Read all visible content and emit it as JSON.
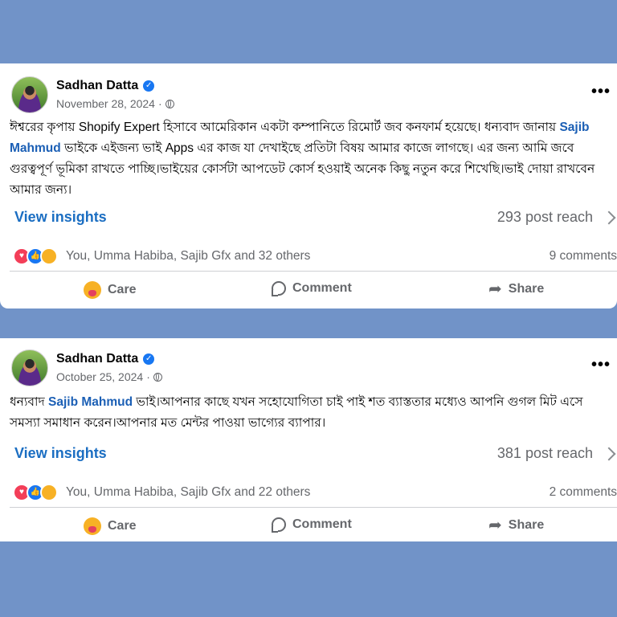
{
  "posts": [
    {
      "author": "Sadhan Datta",
      "verified_icon": "verified-badge-icon",
      "date": "November 28, 2024",
      "separator": "·",
      "text_part1": "ঈশ্বরের কৃপায় Shopify Expert হিসাবে আমেরিকান একটা কম্পানিতে রিমোর্ট জব কনফার্ম হয়েছে। ধন্যবাদ জানায় ",
      "mention": "Sajib Mahmud",
      "text_part2": "  ভাইকে এইজন্য ভাই Apps এর কাজ যা দেখাইছে প্রতিটা বিষয় আমার কাজে লাগছে। এর জন্য আমি জবে গুরত্বপূর্ণ ভূমিকা রাখতে পাচ্ছি।ভাইয়ের কোর্সটা আপডেট কোর্স হওয়াই অনেক কিছু নতুন করে শিখেছি।ভাই দোয়া রাখবেন আমার জন্য।",
      "insights_label": "View insights",
      "reach": "293 post reach",
      "reactors": "You, Umma Habiba, Sajib Gfx and 32 others",
      "comments": "9 comments",
      "actions": {
        "care": "Care",
        "comment": "Comment",
        "share": "Share"
      }
    },
    {
      "author": "Sadhan Datta",
      "verified_icon": "verified-badge-icon",
      "date": "October 25, 2024",
      "separator": "·",
      "text_part1": "ধন্যবাদ ",
      "mention": "Sajib Mahmud",
      "text_part2": "  ভাই।আপনার কাছে যখন সহোযোগিতা চাই পাই শত ব্যাস্ততার মধ্যেও আপনি গুগল মিট এসে সমস্যা সমাধান করেন।আপনার মত মেন্টর পাওয়া ভাগ্যের ব্যাপার।",
      "insights_label": "View insights",
      "reach": "381 post reach",
      "reactors": "You, Umma Habiba, Sajib Gfx and 22 others",
      "comments": "2 comments",
      "actions": {
        "care": "Care",
        "comment": "Comment",
        "share": "Share"
      }
    }
  ],
  "colors": {
    "background": "#7193c8",
    "card": "#ffffff",
    "link": "#1b6ec2",
    "mention": "#1b5fb5",
    "muted": "#65676b"
  }
}
